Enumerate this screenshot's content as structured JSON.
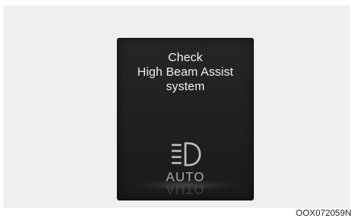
{
  "display": {
    "message_line1": "Check",
    "message_line2": "High Beam Assist",
    "message_line3": "system",
    "icon": "high-beam-icon",
    "status_label": "AUTO"
  },
  "figure_code": "OOX072059N"
}
